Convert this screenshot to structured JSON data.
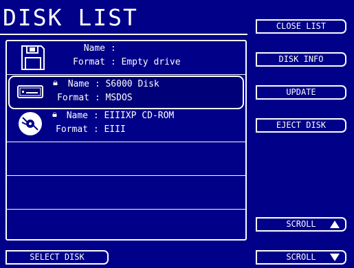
{
  "title": "DISK LIST",
  "side_buttons": {
    "close_list": "CLOSE LIST",
    "disk_info": "DISK INFO",
    "update": "UPDATE",
    "eject_disk": "EJECT DISK",
    "scroll_up": "SCROLL",
    "scroll_down": "SCROLL"
  },
  "bottom": {
    "select_disk": "SELECT DISK"
  },
  "labels": {
    "name": "Name",
    "format": "Format"
  },
  "disks": [
    {
      "icon": "floppy-disk-icon",
      "name": "",
      "format": "Empty drive",
      "locked": false
    },
    {
      "icon": "hard-drive-icon",
      "name": "S6000 Disk",
      "format": "MSDOS",
      "locked": true,
      "selected": true
    },
    {
      "icon": "cd-rom-icon",
      "name": "EIIIXP CD-ROM",
      "format": "EIII",
      "locked": true
    }
  ],
  "colors": {
    "background": "#000088",
    "foreground": "#ffffff"
  }
}
